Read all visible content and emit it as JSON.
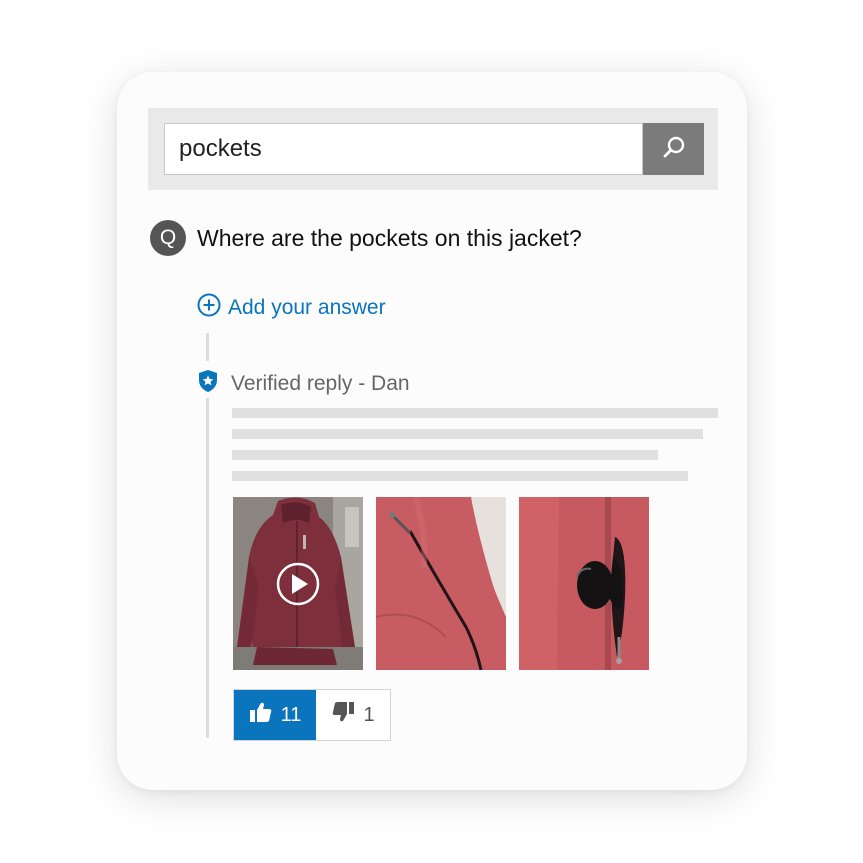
{
  "search": {
    "value": "pockets",
    "button_icon": "search-icon"
  },
  "question": {
    "badge": "Q",
    "text": "Where are the pockets on this jacket?"
  },
  "add_answer": {
    "label": "Add your answer",
    "icon": "plus-circle-icon"
  },
  "reply": {
    "label": "Verified reply - Dan",
    "icon": "verified-shield-icon",
    "photos": [
      {
        "name": "photo-jacket-video",
        "has_play": true
      },
      {
        "name": "photo-jacket-zipper",
        "has_play": false
      },
      {
        "name": "photo-jacket-pocket-sunglasses",
        "has_play": false
      }
    ]
  },
  "votes": {
    "up_count": "11",
    "down_count": "1",
    "up_icon": "thumbs-up-icon",
    "down_icon": "thumbs-down-icon"
  },
  "colors": {
    "accent": "#0a75bd",
    "badge": "#555555",
    "search_button": "#7b7b7b"
  }
}
